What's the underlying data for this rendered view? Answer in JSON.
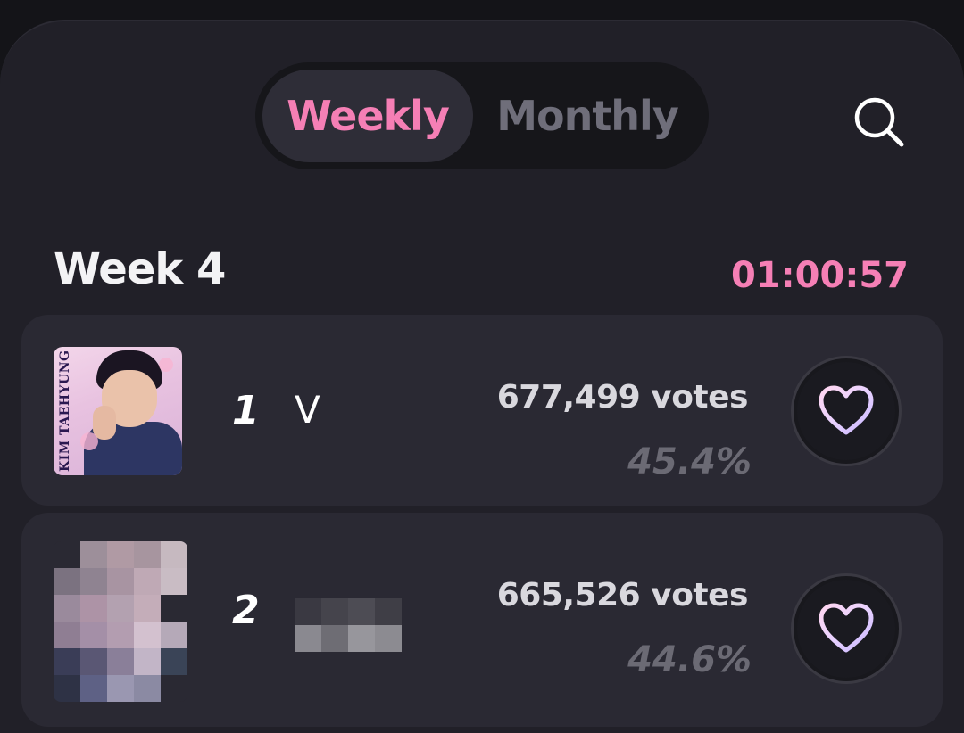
{
  "tabs": {
    "weekly": "Weekly",
    "monthly": "Monthly",
    "active": "Weekly"
  },
  "header": {
    "week_label": "Week 4",
    "timer": "01:00:57"
  },
  "ranking": [
    {
      "rank": "1",
      "name": "V",
      "thumb_text": "KIM TAEHYUNG",
      "votes": "677,499 votes",
      "percent": "45.4%"
    },
    {
      "rank": "2",
      "name": "",
      "votes": "665,526 votes",
      "percent": "44.6%"
    }
  ],
  "colors": {
    "accent_pink": "#f57fb5",
    "panel": "#212028",
    "card": "#2a2933",
    "inactive_text": "#6f6e7a"
  },
  "icons": {
    "search": "search-icon",
    "vote": "heart-icon"
  }
}
